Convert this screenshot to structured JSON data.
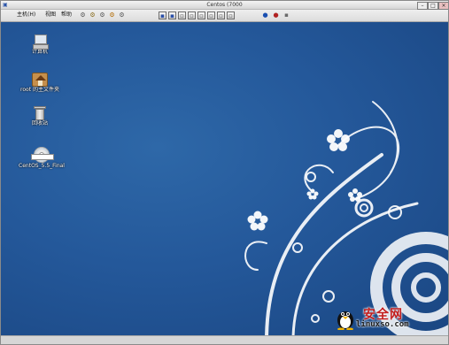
{
  "window": {
    "title": "Centos (7000",
    "controls": {
      "minimize": "–",
      "maximize": "□",
      "close": "×"
    }
  },
  "menubar": {
    "items": [
      "主机(H)",
      "视图",
      "帮助"
    ],
    "left_icons": [
      "connect-icon",
      "snapshot-icon",
      "power-icon",
      "settings-icon",
      "share-icon"
    ],
    "toolbar_icons": [
      "full-screen-icon",
      "save-icon",
      "restore-icon",
      "pause-icon",
      "power-on-icon",
      "power-off-icon",
      "reset-icon",
      "refresh-icon",
      "info-icon",
      "record-icon",
      "close-vm-icon"
    ]
  },
  "desktop": {
    "icons": [
      {
        "name": "computer",
        "label": "计算机"
      },
      {
        "name": "home",
        "label": "root 的主文件夹"
      },
      {
        "name": "trash",
        "label": "回收站"
      },
      {
        "name": "disc",
        "label": "CentOS_5.5_Final"
      }
    ],
    "background_colors": {
      "light": "#2e68a8",
      "dark": "#1a4682"
    }
  },
  "watermark": {
    "cn": "安全网",
    "en": "linuxso.com"
  }
}
